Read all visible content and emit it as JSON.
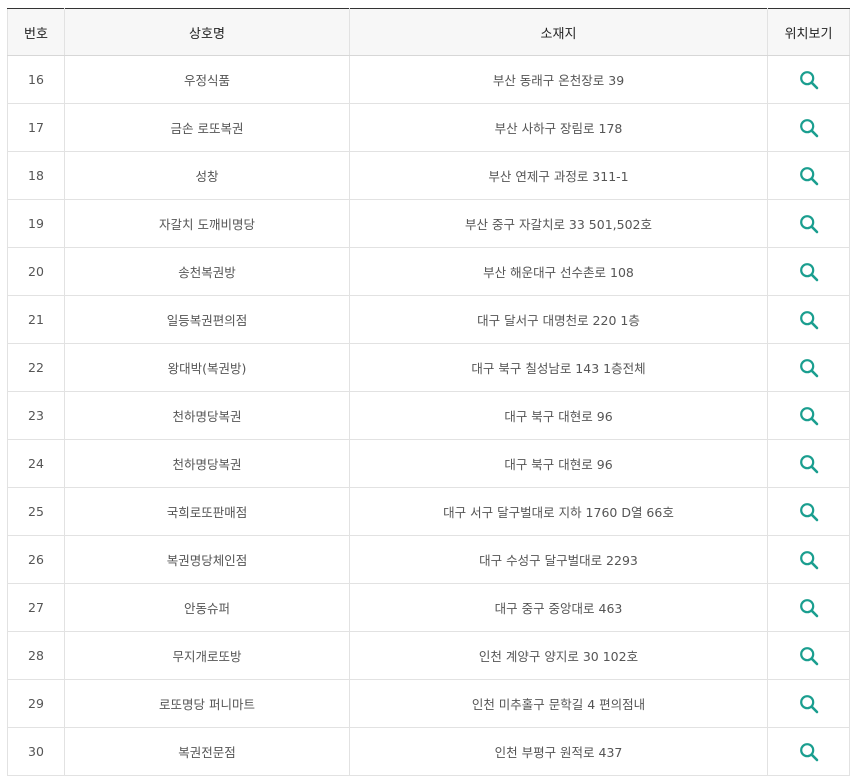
{
  "accent_color": "#1a9e8f",
  "headers": {
    "no": "번호",
    "name": "상호명",
    "address": "소재지",
    "location": "위치보기"
  },
  "rows": [
    {
      "no": "16",
      "name": "우정식품",
      "address": "부산 동래구 온천장로 39",
      "icon": "search-icon"
    },
    {
      "no": "17",
      "name": "금손 로또복권",
      "address": "부산 사하구 장림로 178",
      "icon": "search-icon"
    },
    {
      "no": "18",
      "name": "성창",
      "address": "부산 연제구 과정로 311-1",
      "icon": "search-icon"
    },
    {
      "no": "19",
      "name": "자갈치 도깨비명당",
      "address": "부산 중구 자갈치로 33 501,502호",
      "icon": "search-icon"
    },
    {
      "no": "20",
      "name": "송천복권방",
      "address": "부산 해운대구 선수촌로 108",
      "icon": "search-icon"
    },
    {
      "no": "21",
      "name": "일등복권편의점",
      "address": "대구 달서구 대명천로 220 1층",
      "icon": "search-icon"
    },
    {
      "no": "22",
      "name": "왕대박(복권방)",
      "address": "대구 북구 칠성남로 143 1층전체",
      "icon": "search-icon"
    },
    {
      "no": "23",
      "name": "천하명당복권",
      "address": "대구 북구 대현로 96",
      "icon": "search-icon"
    },
    {
      "no": "24",
      "name": "천하명당복권",
      "address": "대구 북구 대현로 96",
      "icon": "search-icon"
    },
    {
      "no": "25",
      "name": "국희로또판매점",
      "address": "대구 서구 달구벌대로 지하 1760 D열 66호",
      "icon": "search-icon"
    },
    {
      "no": "26",
      "name": "복권명당체인점",
      "address": "대구 수성구 달구벌대로 2293",
      "icon": "search-icon"
    },
    {
      "no": "27",
      "name": "안동슈퍼",
      "address": "대구 중구 중앙대로 463",
      "icon": "search-icon"
    },
    {
      "no": "28",
      "name": "무지개로또방",
      "address": "인천 계양구 양지로 30 102호",
      "icon": "search-icon"
    },
    {
      "no": "29",
      "name": "로또명당 퍼니마트",
      "address": "인천 미추홀구 문학길 4 편의점내",
      "icon": "search-icon"
    },
    {
      "no": "30",
      "name": "복권전문점",
      "address": "인천 부평구 원적로 437",
      "icon": "search-icon"
    }
  ]
}
